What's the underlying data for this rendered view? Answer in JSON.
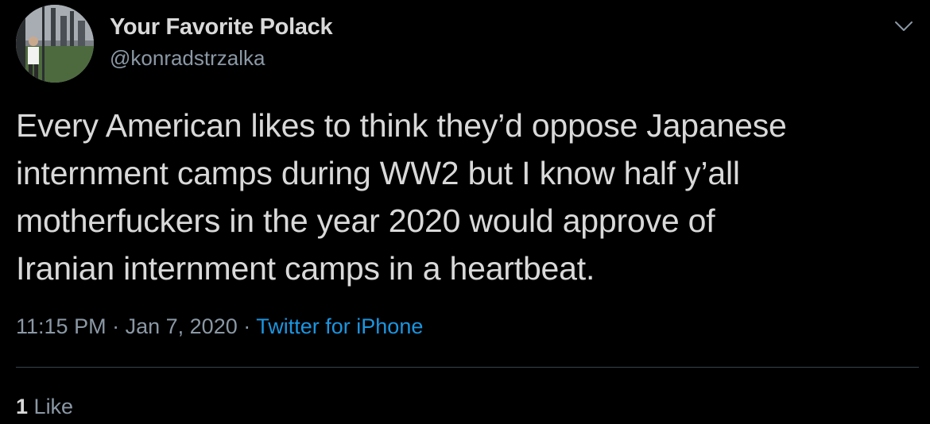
{
  "author": {
    "display_name": "Your Favorite Polack",
    "handle": "@konradstrzalka",
    "avatar_icon": "profile-photo"
  },
  "menu": {
    "icon": "chevron-down-icon"
  },
  "tweet": {
    "text": "Every American likes to think they’d oppose Japanese\ninternment camps during WW2 but I know half y’all\nmotherfuckers in the year 2020 would approve of\nIranian internment camps in a heartbeat."
  },
  "meta": {
    "time": "11:15 PM",
    "separator": "·",
    "date": "Jan 7, 2020",
    "source": "Twitter for iPhone"
  },
  "engagement": {
    "like_count": "1",
    "like_label": "Like"
  },
  "colors": {
    "background": "#000000",
    "text_primary": "#d9d9d9",
    "text_secondary": "#8b98a5",
    "link": "#1b95e0",
    "divider": "#38444d"
  }
}
